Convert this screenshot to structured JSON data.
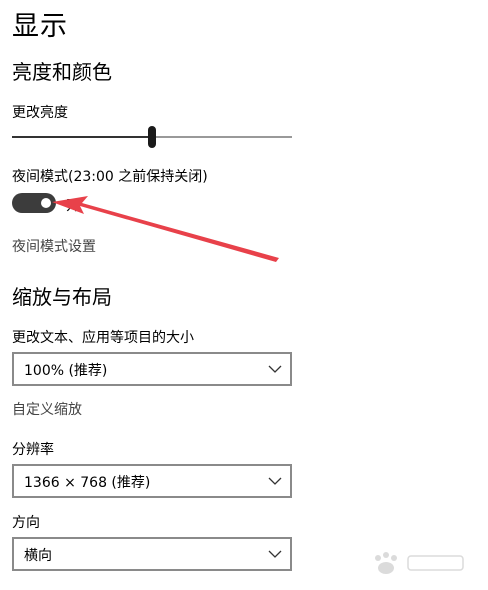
{
  "page": {
    "title": "显示"
  },
  "brightness_color": {
    "section_title": "亮度和颜色",
    "brightness_label": "更改亮度",
    "brightness_level_fraction": 0.5,
    "night_mode_label": "夜间模式(23:00 之前保持关闭)",
    "night_mode_state": "开",
    "night_mode_settings_link": "夜间模式设置"
  },
  "scale_layout": {
    "section_title": "缩放与布局",
    "text_size_label": "更改文本、应用等项目的大小",
    "text_size_value": "100% (推荐)",
    "custom_scaling_link": "自定义缩放",
    "resolution_label": "分辨率",
    "resolution_value": "1366 × 768 (推荐)",
    "orientation_label": "方向",
    "orientation_value": "横向"
  },
  "annotation": {
    "arrow_color": "#e8414a"
  },
  "icons": {
    "dropdown": "chevron-down-icon"
  }
}
